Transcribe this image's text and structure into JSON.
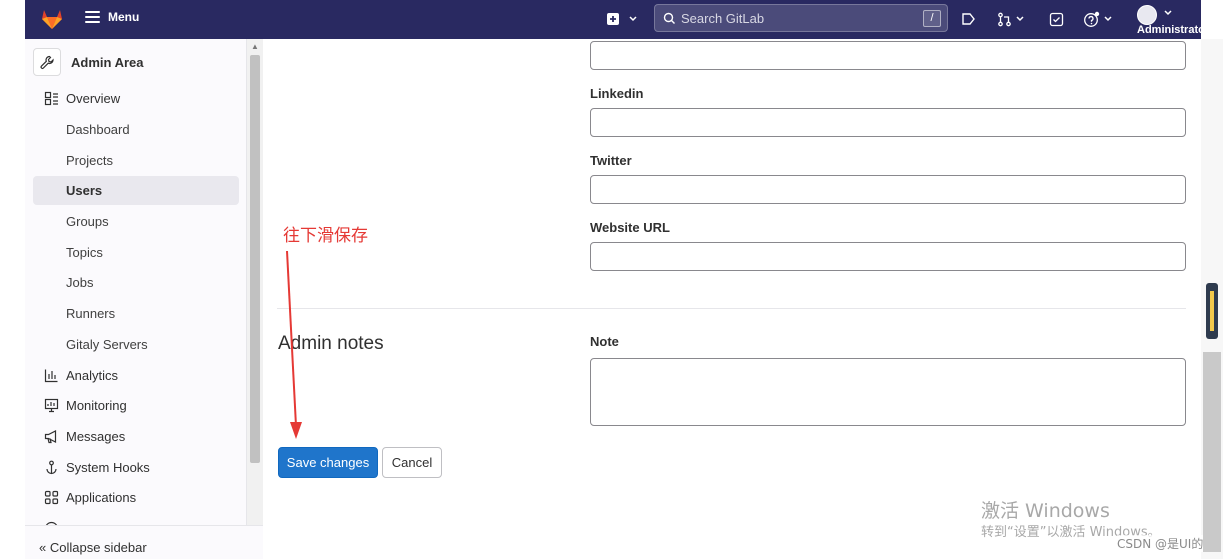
{
  "navbar": {
    "menu_label": "Menu",
    "search_placeholder": "Search GitLab",
    "search_shortcut": "/",
    "user_name": "Administrator"
  },
  "sidebar": {
    "title": "Admin Area",
    "items": [
      {
        "label": "Overview",
        "icon": "overview-icon"
      },
      {
        "label": "Dashboard"
      },
      {
        "label": "Projects"
      },
      {
        "label": "Users"
      },
      {
        "label": "Groups"
      },
      {
        "label": "Topics"
      },
      {
        "label": "Jobs"
      },
      {
        "label": "Runners"
      },
      {
        "label": "Gitaly Servers"
      },
      {
        "label": "Analytics",
        "icon": "analytics-icon"
      },
      {
        "label": "Monitoring",
        "icon": "monitoring-icon"
      },
      {
        "label": "Messages",
        "icon": "messages-icon"
      },
      {
        "label": "System Hooks",
        "icon": "hook-icon"
      },
      {
        "label": "Applications",
        "icon": "applications-icon"
      }
    ],
    "active_item": "Users",
    "collapse_label": "Collapse sidebar"
  },
  "form": {
    "linkedin_label": "Linkedin",
    "linkedin_value": "",
    "twitter_label": "Twitter",
    "twitter_value": "",
    "website_label": "Website URL",
    "website_value": "",
    "admin_notes_title": "Admin notes",
    "note_label": "Note",
    "note_value": "",
    "save_label": "Save changes",
    "cancel_label": "Cancel"
  },
  "annotation": {
    "text": "往下滑保存",
    "color": "#e53935"
  },
  "overlay": {
    "watermark_title": "激活 Windows",
    "watermark_sub": "转到“设置”以激活 Windows。",
    "csdn_label": "CSDN @是UI的"
  },
  "colors": {
    "navbar": "#292961",
    "primary": "#1f75cb"
  }
}
